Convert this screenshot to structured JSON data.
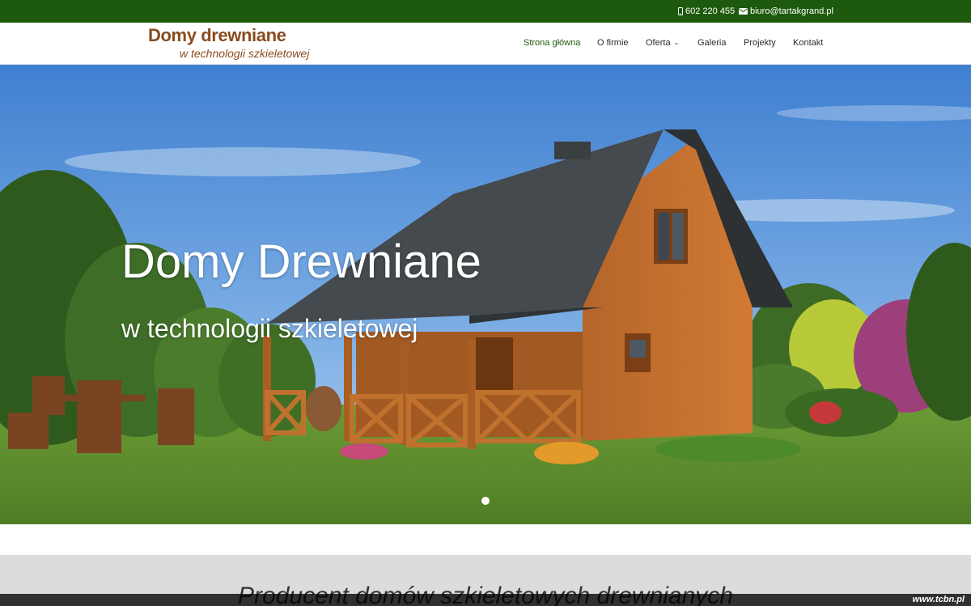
{
  "topbar": {
    "phone": "602 220 455",
    "email": "biuro@tartakgrand.pl",
    "phone_icon": "mobile-phone-icon",
    "email_icon": "envelope-icon"
  },
  "logo": {
    "line1": "Domy drewniane",
    "line2": "w technologii szkieletowej"
  },
  "nav": {
    "items": [
      {
        "label": "Strona główna",
        "active": true
      },
      {
        "label": "O firmie"
      },
      {
        "label": "Oferta",
        "dropdown": true
      },
      {
        "label": "Galeria"
      },
      {
        "label": "Projekty"
      },
      {
        "label": "Kontakt"
      }
    ]
  },
  "hero": {
    "title": "Domy Drewniane",
    "subtitle": "w technologii szkieletowej"
  },
  "section": {
    "title": "Producent domów szkieletowych drewnianych"
  },
  "watermark": "www.tcbn.pl",
  "colors": {
    "brand_green": "#1e5a0d",
    "logo_brown": "#8a4b1d",
    "wood": "#c0712e",
    "roof": "#444a4d"
  }
}
